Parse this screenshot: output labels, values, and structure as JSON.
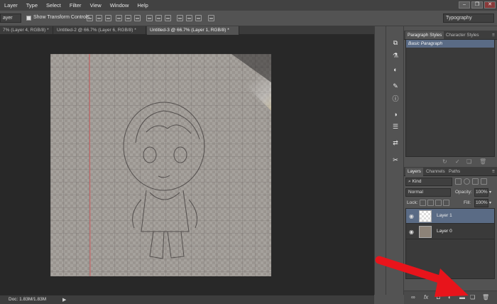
{
  "menu": [
    "Layer",
    "Type",
    "Select",
    "Filter",
    "View",
    "Window",
    "Help"
  ],
  "options_bar": {
    "tool_select": "ayer",
    "show_transform_label": "Show Transform Controls",
    "workspace": "Typography"
  },
  "tabs": [
    "7% (Layer 4, RGB/8) *",
    "Untitled-2 @ 66.7% (Layer 6, RGB/8) *",
    "Untitled-3 @ 66.7% (Layer 1, RGB/8) *"
  ],
  "status": {
    "doc_info": "Doc: 1.83M/1.83M"
  },
  "paragraph_panel": {
    "tabs": [
      "Paragraph Styles",
      "Character Styles"
    ],
    "items": [
      "Basic Paragraph"
    ]
  },
  "layers_panel": {
    "tabs": [
      "Layers",
      "Channels",
      "Paths"
    ],
    "filter": "Kind",
    "blend_mode": "Normal",
    "opacity_label": "Opacity:",
    "opacity": "100%",
    "lock_label": "Lock:",
    "fill_label": "Fill:",
    "fill": "100%",
    "layers": [
      {
        "name": "Layer 1",
        "selected": true
      },
      {
        "name": "Layer 0",
        "selected": false
      }
    ]
  },
  "colors": {
    "annotation_arrow": "#e8141b",
    "selection": "#5a6b85"
  },
  "icons": [
    "eye-icon",
    "link-icon",
    "fx-icon",
    "mask-icon",
    "adjustment-icon",
    "group-folder-icon",
    "new-layer-icon",
    "trash-icon"
  ]
}
